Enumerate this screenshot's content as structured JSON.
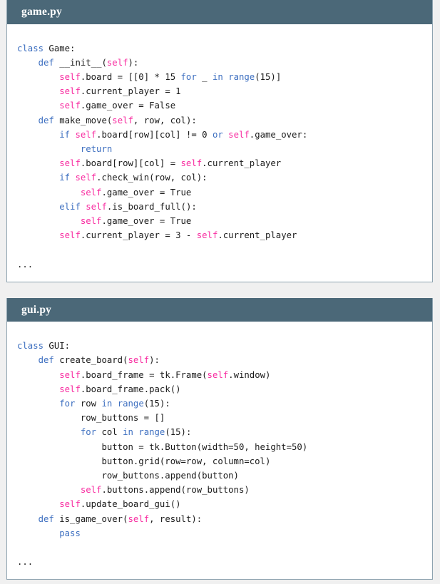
{
  "theme": {
    "page_background": "#f0f0f0",
    "header_background": "#4b6878",
    "header_text": "#ffffff",
    "card_background": "#ffffff",
    "card_border": "#8ea3b0",
    "keyword_color": "#3d6fc0",
    "self_color": "#f82ba0",
    "plain_text_color": "#1a1a1a"
  },
  "cards": [
    {
      "title": "game.py",
      "language": "python",
      "lines": [
        [
          {
            "t": "class ",
            "c": "kw"
          },
          {
            "t": "Game:",
            "c": "pl"
          }
        ],
        [
          {
            "t": "    ",
            "c": "pl"
          },
          {
            "t": "def ",
            "c": "kw"
          },
          {
            "t": "__init__(",
            "c": "pl"
          },
          {
            "t": "self",
            "c": "slf"
          },
          {
            "t": "):",
            "c": "pl"
          }
        ],
        [
          {
            "t": "        ",
            "c": "pl"
          },
          {
            "t": "self",
            "c": "slf"
          },
          {
            "t": ".board = [[0] * 15 ",
            "c": "pl"
          },
          {
            "t": "for ",
            "c": "kw"
          },
          {
            "t": "_ ",
            "c": "pl"
          },
          {
            "t": "in ",
            "c": "kw"
          },
          {
            "t": "range",
            "c": "kw"
          },
          {
            "t": "(15)]",
            "c": "pl"
          }
        ],
        [
          {
            "t": "        ",
            "c": "pl"
          },
          {
            "t": "self",
            "c": "slf"
          },
          {
            "t": ".current_player = 1",
            "c": "pl"
          }
        ],
        [
          {
            "t": "        ",
            "c": "pl"
          },
          {
            "t": "self",
            "c": "slf"
          },
          {
            "t": ".game_over = False",
            "c": "pl"
          }
        ],
        [
          {
            "t": "    ",
            "c": "pl"
          },
          {
            "t": "def ",
            "c": "kw"
          },
          {
            "t": "make_move(",
            "c": "pl"
          },
          {
            "t": "self",
            "c": "slf"
          },
          {
            "t": ", row, col):",
            "c": "pl"
          }
        ],
        [
          {
            "t": "        ",
            "c": "pl"
          },
          {
            "t": "if ",
            "c": "kw"
          },
          {
            "t": "self",
            "c": "slf"
          },
          {
            "t": ".board[row][col] != 0 ",
            "c": "pl"
          },
          {
            "t": "or ",
            "c": "kw"
          },
          {
            "t": "self",
            "c": "slf"
          },
          {
            "t": ".game_over:",
            "c": "pl"
          }
        ],
        [
          {
            "t": "            ",
            "c": "pl"
          },
          {
            "t": "return",
            "c": "kw"
          }
        ],
        [
          {
            "t": "        ",
            "c": "pl"
          },
          {
            "t": "self",
            "c": "slf"
          },
          {
            "t": ".board[row][col] = ",
            "c": "pl"
          },
          {
            "t": "self",
            "c": "slf"
          },
          {
            "t": ".current_player",
            "c": "pl"
          }
        ],
        [
          {
            "t": "        ",
            "c": "pl"
          },
          {
            "t": "if ",
            "c": "kw"
          },
          {
            "t": "self",
            "c": "slf"
          },
          {
            "t": ".check_win(row, col):",
            "c": "pl"
          }
        ],
        [
          {
            "t": "            ",
            "c": "pl"
          },
          {
            "t": "self",
            "c": "slf"
          },
          {
            "t": ".game_over = True",
            "c": "pl"
          }
        ],
        [
          {
            "t": "        ",
            "c": "pl"
          },
          {
            "t": "elif ",
            "c": "kw"
          },
          {
            "t": "self",
            "c": "slf"
          },
          {
            "t": ".is_board_full():",
            "c": "pl"
          }
        ],
        [
          {
            "t": "            ",
            "c": "pl"
          },
          {
            "t": "self",
            "c": "slf"
          },
          {
            "t": ".game_over = True",
            "c": "pl"
          }
        ],
        [
          {
            "t": "        ",
            "c": "pl"
          },
          {
            "t": "self",
            "c": "slf"
          },
          {
            "t": ".current_player = 3 - ",
            "c": "pl"
          },
          {
            "t": "self",
            "c": "slf"
          },
          {
            "t": ".current_player",
            "c": "pl"
          }
        ],
        [],
        [
          {
            "t": "...",
            "c": "pl"
          }
        ]
      ]
    },
    {
      "title": "gui.py",
      "language": "python",
      "lines": [
        [
          {
            "t": "class ",
            "c": "kw"
          },
          {
            "t": "GUI:",
            "c": "pl"
          }
        ],
        [
          {
            "t": "    ",
            "c": "pl"
          },
          {
            "t": "def ",
            "c": "kw"
          },
          {
            "t": "create_board(",
            "c": "pl"
          },
          {
            "t": "self",
            "c": "slf"
          },
          {
            "t": "):",
            "c": "pl"
          }
        ],
        [
          {
            "t": "        ",
            "c": "pl"
          },
          {
            "t": "self",
            "c": "slf"
          },
          {
            "t": ".board_frame = tk.Frame(",
            "c": "pl"
          },
          {
            "t": "self",
            "c": "slf"
          },
          {
            "t": ".window)",
            "c": "pl"
          }
        ],
        [
          {
            "t": "        ",
            "c": "pl"
          },
          {
            "t": "self",
            "c": "slf"
          },
          {
            "t": ".board_frame.pack()",
            "c": "pl"
          }
        ],
        [
          {
            "t": "        ",
            "c": "pl"
          },
          {
            "t": "for ",
            "c": "kw"
          },
          {
            "t": "row ",
            "c": "pl"
          },
          {
            "t": "in ",
            "c": "kw"
          },
          {
            "t": "range",
            "c": "kw"
          },
          {
            "t": "(15):",
            "c": "pl"
          }
        ],
        [
          {
            "t": "            row_buttons = []",
            "c": "pl"
          }
        ],
        [
          {
            "t": "            ",
            "c": "pl"
          },
          {
            "t": "for ",
            "c": "kw"
          },
          {
            "t": "col ",
            "c": "pl"
          },
          {
            "t": "in ",
            "c": "kw"
          },
          {
            "t": "range",
            "c": "kw"
          },
          {
            "t": "(15):",
            "c": "pl"
          }
        ],
        [
          {
            "t": "                button = tk.Button(width=50, height=50)",
            "c": "pl"
          }
        ],
        [
          {
            "t": "                button.grid(row=row, column=col)",
            "c": "pl"
          }
        ],
        [
          {
            "t": "                row_buttons.append(button)",
            "c": "pl"
          }
        ],
        [
          {
            "t": "            ",
            "c": "pl"
          },
          {
            "t": "self",
            "c": "slf"
          },
          {
            "t": ".buttons.append(row_buttons)",
            "c": "pl"
          }
        ],
        [
          {
            "t": "        ",
            "c": "pl"
          },
          {
            "t": "self",
            "c": "slf"
          },
          {
            "t": ".update_board_gui()",
            "c": "pl"
          }
        ],
        [
          {
            "t": "    ",
            "c": "pl"
          },
          {
            "t": "def ",
            "c": "kw"
          },
          {
            "t": "is_game_over(",
            "c": "pl"
          },
          {
            "t": "self",
            "c": "slf"
          },
          {
            "t": ", result):",
            "c": "pl"
          }
        ],
        [
          {
            "t": "        ",
            "c": "pl"
          },
          {
            "t": "pass",
            "c": "kw"
          }
        ],
        [],
        [
          {
            "t": "...",
            "c": "pl"
          }
        ]
      ]
    }
  ]
}
